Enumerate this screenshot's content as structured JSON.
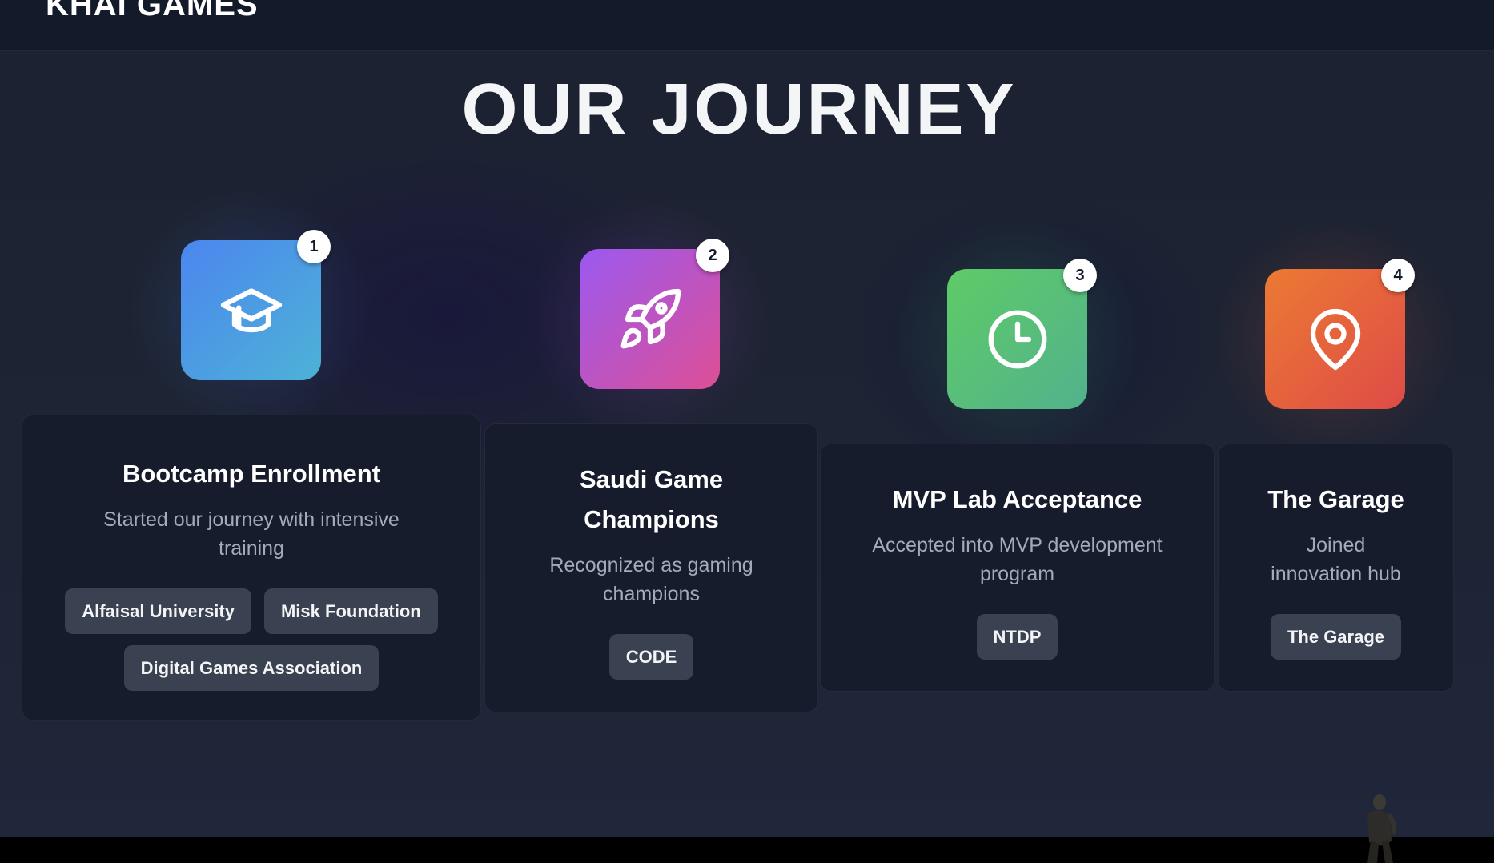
{
  "header": {
    "brand": "KHAI GAMES"
  },
  "page_title": "OUR JOURNEY",
  "milestones": [
    {
      "number": "1",
      "icon": "graduation-cap-icon",
      "title": "Bootcamp Enrollment",
      "description": "Started our journey with intensive training",
      "tags": [
        "Alfaisal University",
        "Misk Foundation",
        "Digital Games Association"
      ]
    },
    {
      "number": "2",
      "icon": "rocket-icon",
      "title": "Saudi Game Champions",
      "description": "Recognized as gaming champions",
      "tags": [
        "CODE"
      ]
    },
    {
      "number": "3",
      "icon": "clock-icon",
      "title": "MVP Lab Acceptance",
      "description": "Accepted into MVP development program",
      "tags": [
        "NTDP"
      ]
    },
    {
      "number": "4",
      "icon": "map-pin-icon",
      "title": "The Garage",
      "description": "Joined innovation hub",
      "tags": [
        "The Garage"
      ]
    }
  ],
  "colors": {
    "milestone1_gradient": [
      "#4c86ef",
      "#4db2d6"
    ],
    "milestone2_gradient": [
      "#9b59f0",
      "#dd4f96"
    ],
    "milestone3_gradient": [
      "#5ecb67",
      "#52b28c"
    ],
    "milestone4_gradient": [
      "#ec7a33",
      "#de4b47"
    ]
  }
}
